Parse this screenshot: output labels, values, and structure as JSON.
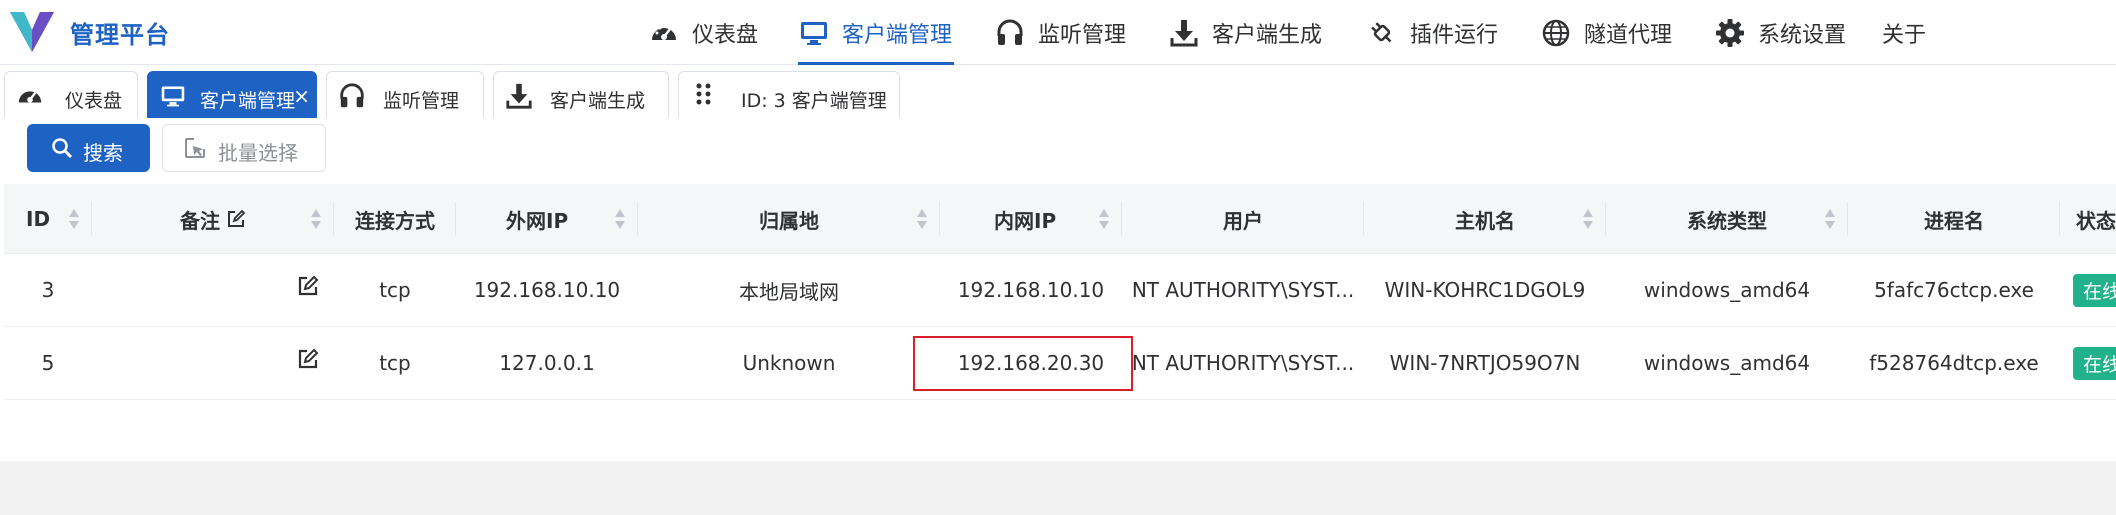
{
  "app": {
    "title": "管理平台"
  },
  "colors": {
    "accent": "#1e62c4",
    "status_online": "#21b28c",
    "highlight_border": "#d9202a"
  },
  "nav": {
    "items": [
      {
        "label": "仪表盘",
        "icon": "dashboard-gauge-icon"
      },
      {
        "label": "客户端管理",
        "icon": "monitor-icon",
        "active": true
      },
      {
        "label": "监听管理",
        "icon": "headphones-icon"
      },
      {
        "label": "客户端生成",
        "icon": "download-icon"
      },
      {
        "label": "插件运行",
        "icon": "plug-icon"
      },
      {
        "label": "隧道代理",
        "icon": "globe-icon"
      },
      {
        "label": "系统设置",
        "icon": "gear-icon"
      },
      {
        "label": "关于",
        "icon": ""
      }
    ]
  },
  "tabs": [
    {
      "label": "仪表盘",
      "icon": "dashboard-gauge-icon"
    },
    {
      "label": "客户端管理",
      "icon": "monitor-icon",
      "active": true,
      "close": "×"
    },
    {
      "label": "监听管理",
      "icon": "headphones-icon"
    },
    {
      "label": "客户端生成",
      "icon": "download-icon"
    },
    {
      "label": "ID: 3 客户端管理",
      "icon": "drag-handle-icon"
    }
  ],
  "toolbar": {
    "search_label": "搜索",
    "batch_label": "批量选择"
  },
  "table": {
    "columns": [
      {
        "key": "id",
        "label": "ID",
        "sortable": true
      },
      {
        "key": "remark",
        "label": "备注",
        "sortable": true,
        "editable": true
      },
      {
        "key": "conn",
        "label": "连接方式",
        "sortable": false
      },
      {
        "key": "wan_ip",
        "label": "外网IP",
        "sortable": true
      },
      {
        "key": "location",
        "label": "归属地",
        "sortable": true
      },
      {
        "key": "lan_ip",
        "label": "内网IP",
        "sortable": true
      },
      {
        "key": "user",
        "label": "用户",
        "sortable": false
      },
      {
        "key": "hostname",
        "label": "主机名",
        "sortable": true
      },
      {
        "key": "os",
        "label": "系统类型",
        "sortable": true
      },
      {
        "key": "process",
        "label": "进程名",
        "sortable": false
      },
      {
        "key": "status",
        "label": "状态",
        "sortable": false
      }
    ],
    "rows": [
      {
        "id": "3",
        "remark": "",
        "conn": "tcp",
        "wan_ip": "192.168.10.10",
        "location": "本地局域网",
        "lan_ip": "192.168.10.10",
        "user": "NT AUTHORITY\\SYST...",
        "hostname": "WIN-KOHRC1DGOL9",
        "os": "windows_amd64",
        "process": "5fafc76ctcp.exe",
        "status": "在线"
      },
      {
        "id": "5",
        "remark": "",
        "conn": "tcp",
        "wan_ip": "127.0.0.1",
        "location": "Unknown",
        "lan_ip": "192.168.20.30",
        "user": "NT AUTHORITY\\SYST...",
        "hostname": "WIN-7NRTJO59O7N",
        "os": "windows_amd64",
        "process": "f528764dtcp.exe",
        "status": "在线"
      }
    ]
  }
}
